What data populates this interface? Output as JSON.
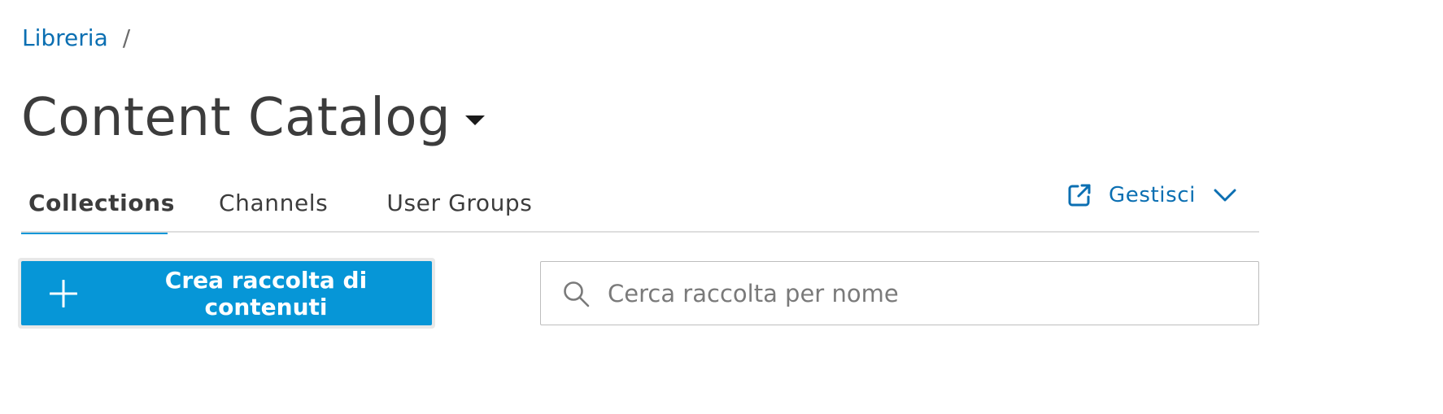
{
  "breadcrumb": {
    "items": [
      {
        "label": "Libreria"
      }
    ],
    "separator": "/"
  },
  "header": {
    "title": "Content Catalog",
    "title_dropdown_icon": "caret-down-icon"
  },
  "tabs": [
    {
      "label": "Collections",
      "active": true
    },
    {
      "label": "Channels",
      "active": false
    },
    {
      "label": "User Groups",
      "active": false
    }
  ],
  "manage": {
    "label": "Gestisci",
    "icon": "external-link-icon",
    "chevron_icon": "chevron-down-icon"
  },
  "toolbar": {
    "create_label": "Crea raccolta di contenuti",
    "create_icon": "plus-icon"
  },
  "search": {
    "placeholder": "Cerca raccolta per nome",
    "value": "",
    "icon": "search-icon"
  },
  "colors": {
    "accent": "#0696d7",
    "link": "#0b6fb2",
    "text": "#3c3c3c"
  }
}
